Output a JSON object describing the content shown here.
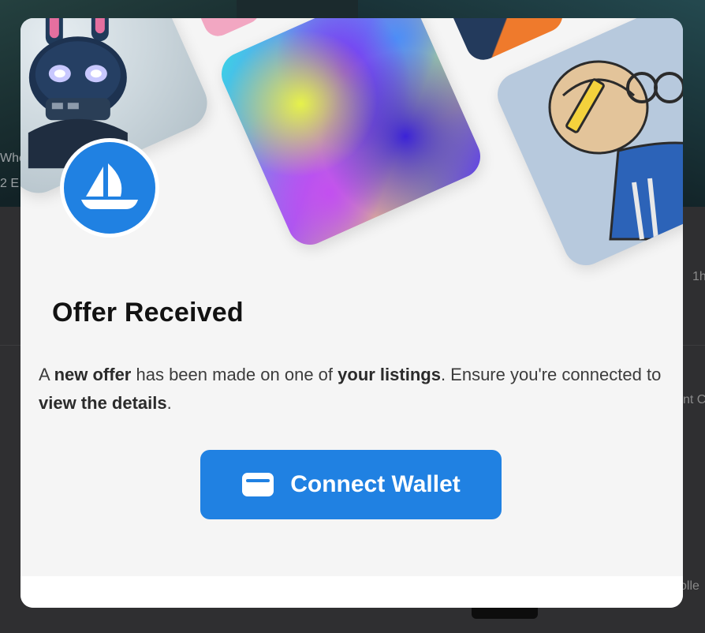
{
  "background": {
    "fragments": {
      "hero_line1": "Whe",
      "hero_line2": "2 E",
      "right_1": "1h",
      "right_2": "nt C",
      "right_3": "olle"
    }
  },
  "modal": {
    "logo": "opensea-sailboat-logo",
    "title": "Offer Received",
    "description": {
      "part1": "A ",
      "bold1": "new offer",
      "part2": " has been made on one of ",
      "bold2": "your listings",
      "part3": ". Ensure you're connected to ",
      "bold3": "view the details",
      "part4": "."
    },
    "connect_button": {
      "icon": "wallet-icon",
      "label": "Connect Wallet"
    }
  },
  "colors": {
    "accent": "#2081e2",
    "modal_bg": "#f5f5f5",
    "title": "#121212"
  }
}
